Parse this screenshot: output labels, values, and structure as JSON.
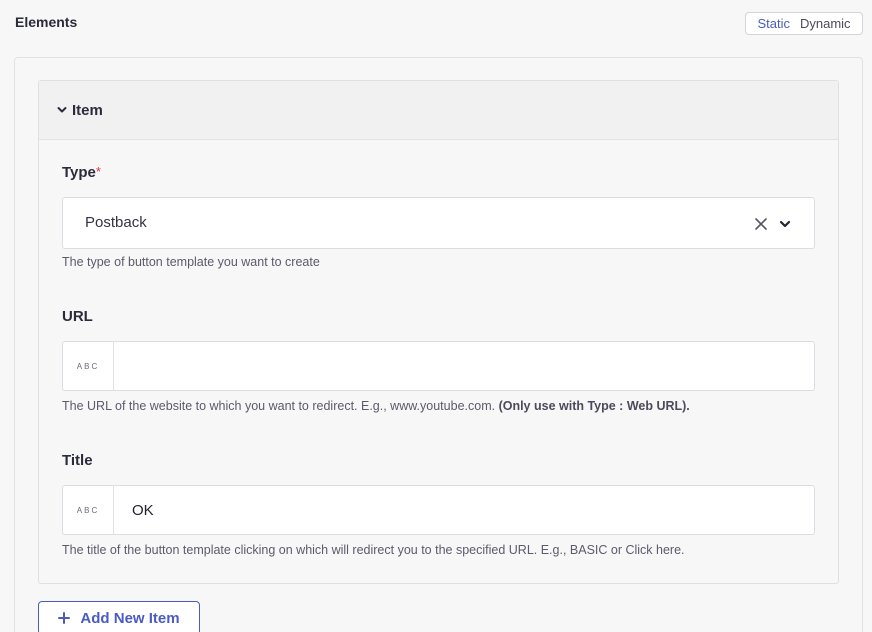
{
  "header": {
    "title": "Elements",
    "toggle": {
      "active": "Static",
      "inactive": "Dynamic"
    }
  },
  "item": {
    "title": "Item",
    "type": {
      "label": "Type",
      "required_mark": "*",
      "value": "Postback",
      "help": "The type of button template you want to create"
    },
    "url": {
      "label": "URL",
      "prefix": "ABC",
      "value": "",
      "help": "The URL of the website to which you want to redirect. E.g., www.youtube.com.",
      "help_bold": "(Only use with Type : Web URL)."
    },
    "title_field": {
      "label": "Title",
      "prefix": "ABC",
      "value": "OK",
      "help": "The title of the button template clicking on which will redirect you to the specified URL. E.g., BASIC or Click here."
    }
  },
  "add_button": {
    "label": "Add New Item"
  },
  "colors": {
    "accent": "#4a5bc4",
    "required": "#e0394a"
  }
}
